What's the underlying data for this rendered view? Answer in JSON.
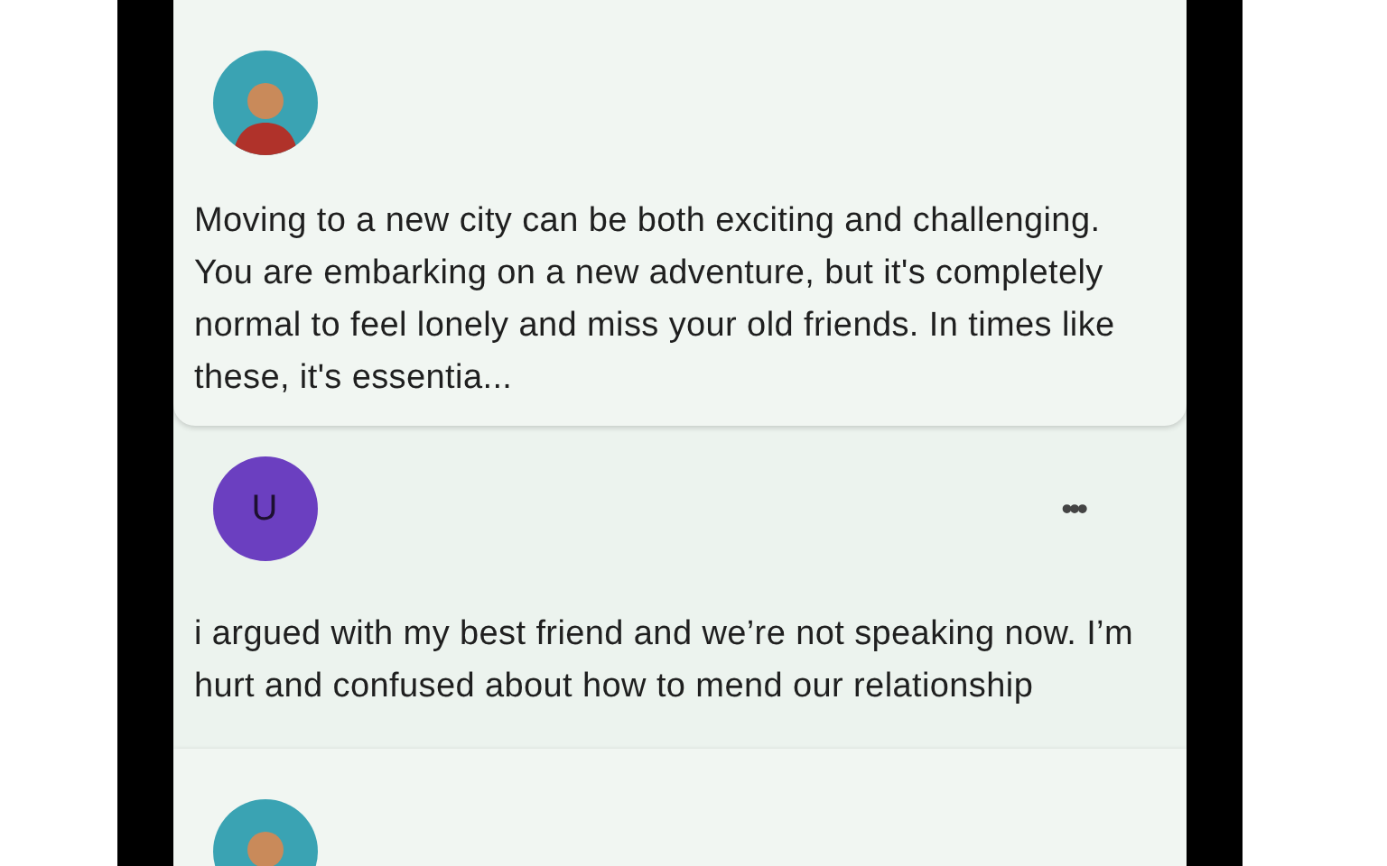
{
  "messages": [
    {
      "kind": "bot",
      "text": "Moving to a new city can be both exciting and challenging. You are embarking on a new adventure, but it's completely normal to feel lonely and miss your old friends. In times like these, it's essentia..."
    },
    {
      "kind": "user",
      "initial": "U",
      "menu": "•••",
      "text": "i argued with my best friend and we’re not speaking now. I’m hurt and confused about how to mend our relationship"
    },
    {
      "kind": "bot"
    }
  ]
}
